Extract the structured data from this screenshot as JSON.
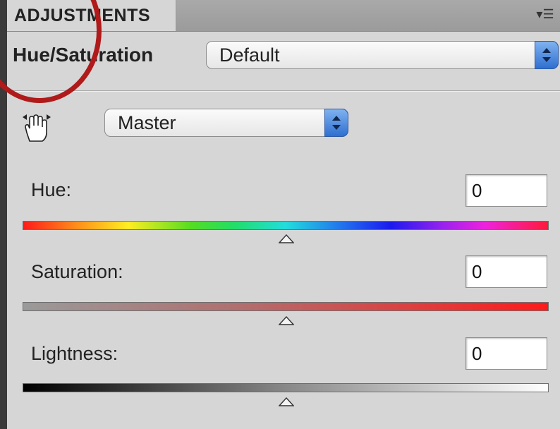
{
  "tab": {
    "label": "ADJUSTMENTS"
  },
  "header": {
    "title": "Hue/Saturation",
    "preset_value": "Default"
  },
  "channel": {
    "value": "Master"
  },
  "sliders": {
    "hue": {
      "label": "Hue:",
      "value": "0"
    },
    "saturation": {
      "label": "Saturation:",
      "value": "0"
    },
    "lightness": {
      "label": "Lightness:",
      "value": "0"
    }
  },
  "colors": {
    "annotation_circle": "#b01a1a",
    "accent": "#2f6fd0",
    "panel_bg": "#d6d6d6"
  },
  "icons": [
    "panel-menu-icon",
    "targeted-adjustment-hand-icon",
    "slider-thumb-icon",
    "select-arrows-icon"
  ]
}
